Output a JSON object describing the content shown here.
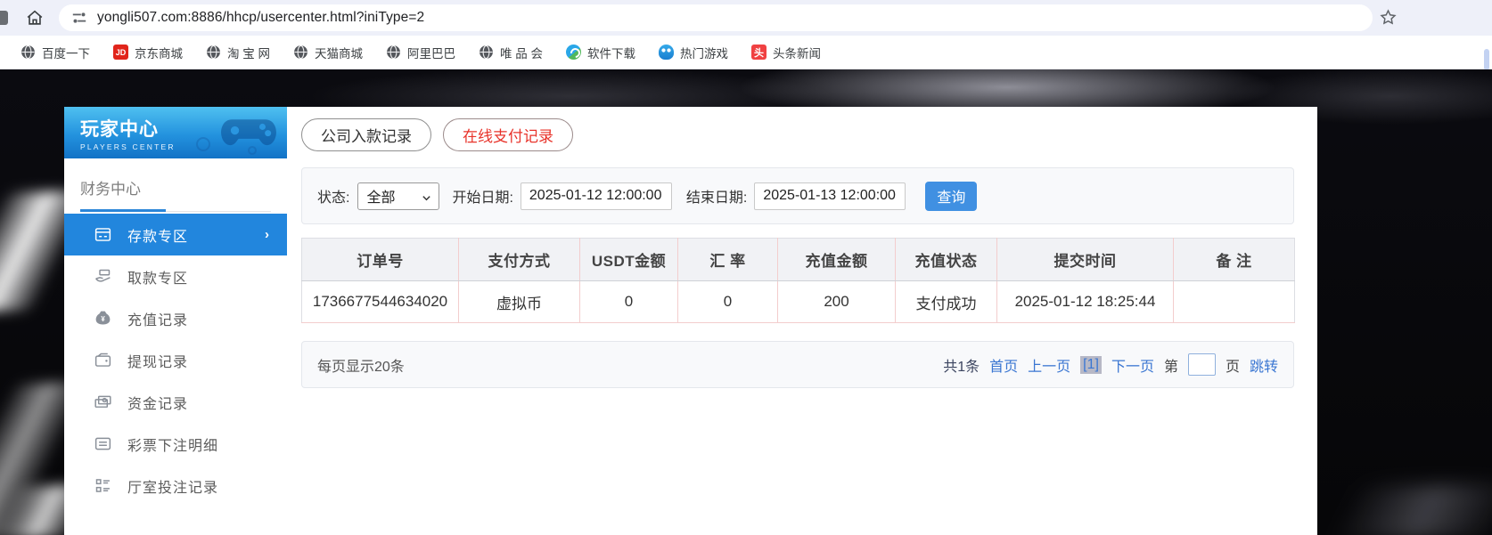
{
  "browser": {
    "url": "yongli507.com:8886/hhcp/usercenter.html?iniType=2",
    "bookmarks": [
      {
        "label": "百度一下",
        "icon": "globe-favicon"
      },
      {
        "label": "京东商城",
        "icon": "jd-favicon",
        "badge": "JD"
      },
      {
        "label": "淘 宝 网",
        "icon": "globe-favicon"
      },
      {
        "label": "天猫商城",
        "icon": "globe-favicon"
      },
      {
        "label": "阿里巴巴",
        "icon": "globe-favicon"
      },
      {
        "label": "唯 品 会",
        "icon": "globe-favicon"
      },
      {
        "label": "软件下载",
        "icon": "software-favicon"
      },
      {
        "label": "热门游戏",
        "icon": "game-favicon"
      },
      {
        "label": "头条新闻",
        "icon": "toutiao-favicon",
        "badge": "头"
      }
    ]
  },
  "sidebar": {
    "title": "玩家中心",
    "subtitle": "PLAYERS CENTER",
    "section": "财务中心",
    "items": [
      {
        "label": "存款专区",
        "icon": "deposit-card-icon",
        "active": true
      },
      {
        "label": "取款专区",
        "icon": "withdraw-hand-icon",
        "active": false
      },
      {
        "label": "充值记录",
        "icon": "money-bag-icon",
        "active": false
      },
      {
        "label": "提现记录",
        "icon": "wallet-icon",
        "active": false
      },
      {
        "label": "资金记录",
        "icon": "banknotes-icon",
        "active": false
      },
      {
        "label": "彩票下注明细",
        "icon": "list-card-icon",
        "active": false
      },
      {
        "label": "厅室投注记录",
        "icon": "list-bullets-icon",
        "active": false
      }
    ]
  },
  "tabs": [
    {
      "label": "公司入款记录",
      "active": false
    },
    {
      "label": "在线支付记录",
      "active": true
    }
  ],
  "filters": {
    "status_label": "状态:",
    "status_value": "全部",
    "start_label": "开始日期:",
    "start_value": "2025-01-12 12:00:00",
    "end_label": "结束日期:",
    "end_value": "2025-01-13 12:00:00",
    "search_label": "查询"
  },
  "table": {
    "headers": [
      "订单号",
      "支付方式",
      "USDT金额",
      "汇 率",
      "充值金额",
      "充值状态",
      "提交时间",
      "备 注"
    ],
    "rows": [
      [
        "1736677544634020",
        "虚拟币",
        "0",
        "0",
        "200",
        "支付成功",
        "2025-01-12 18:25:44",
        ""
      ]
    ]
  },
  "pagination": {
    "per_page": "每页显示20条",
    "total": "共1条",
    "first": "首页",
    "prev": "上一页",
    "current": "[1]",
    "next": "下一页",
    "page_prefix": "第",
    "page_suffix": "页",
    "jump": "跳转"
  },
  "colors": {
    "accent_blue": "#2286dd",
    "active_tab_red": "#e8332a",
    "link_blue": "#3a76d2",
    "query_button_blue": "#4090e2",
    "jd_red": "#e1251b",
    "toutiao_red": "#f04142",
    "table_separator_pink": "#f3cdcd",
    "sidebar_gradient_top": "#4fc0f0",
    "sidebar_gradient_bottom": "#1272c6"
  }
}
